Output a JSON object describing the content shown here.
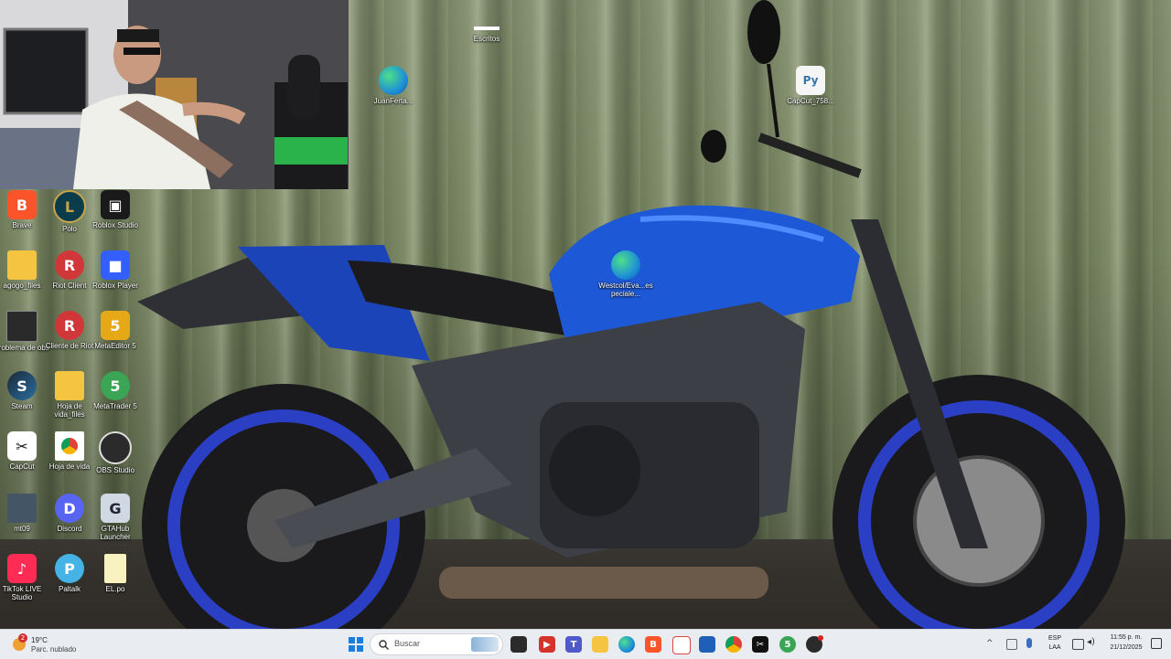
{
  "desktop_icons": [
    {
      "label": "Escritos",
      "icon": "blank-file-icon",
      "color": "#ffffff"
    },
    {
      "label": "JuanFerta...",
      "icon": "edge-icon",
      "color": "#1e90d6"
    },
    {
      "label": "CapCut_758...",
      "icon": "python-file-icon",
      "color": "#f5f5f5"
    },
    {
      "label": "Brave",
      "icon": "brave-icon",
      "color": "#fb542b"
    },
    {
      "label": "Polo",
      "icon": "league-icon",
      "color": "#0a3c4a"
    },
    {
      "label": "Roblox Studio",
      "icon": "roblox-studio-icon",
      "color": "#1a1a1a"
    },
    {
      "label": "agogo_files",
      "icon": "folder-icon",
      "color": "#f5c542"
    },
    {
      "label": "Riot Client",
      "icon": "riot-icon",
      "color": "#d13639"
    },
    {
      "label": "Roblox Player",
      "icon": "roblox-icon",
      "color": "#335fff"
    },
    {
      "label": "problema de obs",
      "icon": "screenshot-file-icon",
      "color": "#2a2a2a"
    },
    {
      "label": "Cliente de Riot",
      "icon": "riot-icon",
      "color": "#d13639"
    },
    {
      "label": "MetaEditor 5",
      "icon": "metaeditor-icon",
      "color": "#e6a817"
    },
    {
      "label": "Steam",
      "icon": "steam-icon",
      "color": "#1b2838"
    },
    {
      "label": "Hoja de vida_files",
      "icon": "folder-icon",
      "color": "#f5c542"
    },
    {
      "label": "MetaTrader 5",
      "icon": "metatrader-icon",
      "color": "#3aa655"
    },
    {
      "label": "CapCut",
      "icon": "capcut-icon",
      "color": "#111111"
    },
    {
      "label": "Hoja de vida",
      "icon": "chrome-file-icon",
      "color": "#ffffff"
    },
    {
      "label": "OBS Studio",
      "icon": "obs-icon",
      "color": "#2b2b2b"
    },
    {
      "label": "mt09",
      "icon": "image-file-icon",
      "color": "#445566"
    },
    {
      "label": "Discord",
      "icon": "discord-icon",
      "color": "#5865f2"
    },
    {
      "label": "GTAHub Launcher",
      "icon": "gtahub-icon",
      "color": "#cfd8e3"
    },
    {
      "label": "TikTok LIVE Studio",
      "icon": "tiktok-icon",
      "color": "#fe2c55"
    },
    {
      "label": "Paltalk",
      "icon": "paltalk-icon",
      "color": "#46b3e6"
    },
    {
      "label": "EL.po",
      "icon": "text-file-icon",
      "color": "#f7f2c0"
    },
    {
      "label": "Westcol/Eva...especiale...",
      "icon": "edge-icon",
      "color": "#1e90d6"
    }
  ],
  "taskbar": {
    "weather_temp": "19°C",
    "weather_condition": "Parc. nublado",
    "weather_badge": "2",
    "search_placeholder": "Buscar",
    "apps": [
      "start-icon",
      "search-icon",
      "widgets-icon",
      "task-view-icon",
      "video-editor-icon",
      "teams-icon",
      "file-explorer-icon",
      "edge-icon",
      "brave-icon",
      "calendar-icon",
      "store-icon",
      "chrome-icon",
      "capcut-icon",
      "metatrader-icon",
      "obs-icon"
    ],
    "language_line1": "ESP",
    "language_line2": "LAA",
    "time": "11:55 p. m.",
    "date": "21/12/2025"
  }
}
